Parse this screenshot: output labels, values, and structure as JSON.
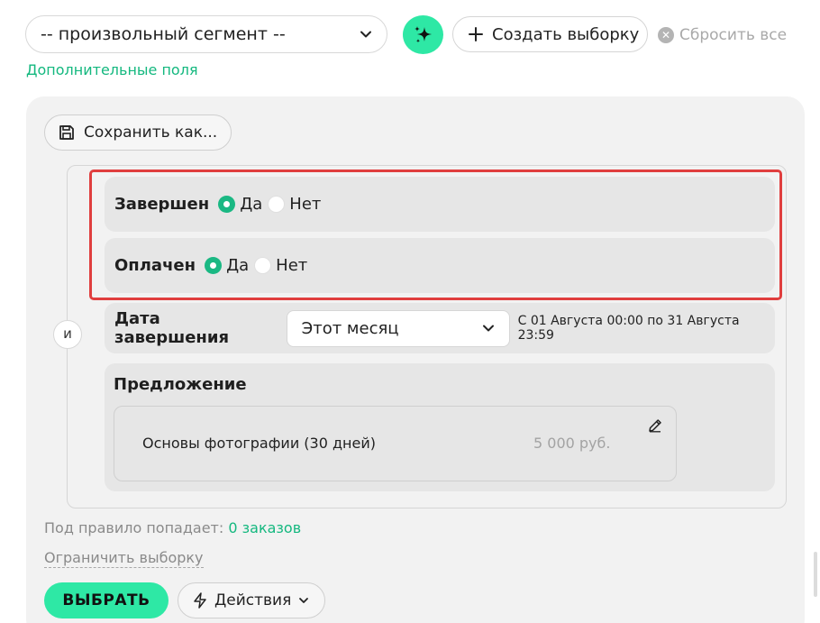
{
  "toolbar": {
    "segment_value": "-- произвольный сегмент --",
    "create_label": "Создать выборку",
    "reset_label": "Сбросить все",
    "extra_fields_link": "Дополнительные поля"
  },
  "panel": {
    "save_as_label": "Сохранить как...",
    "logic_operator": "и",
    "rules": {
      "completed": {
        "label": "Завершен",
        "options": [
          "Да",
          "Нет"
        ],
        "selected": "Да"
      },
      "paid": {
        "label": "Оплачен",
        "options": [
          "Да",
          "Нет"
        ],
        "selected": "Да"
      },
      "completion_date": {
        "label": "Дата завершения",
        "period_value": "Этот месяц",
        "range_text": "С 01 Августа 00:00 по 31 Августа 23:59"
      },
      "offer": {
        "label": "Предложение",
        "item_name": "Основы фотографии (30 дней)",
        "item_price": "5 000 руб."
      }
    },
    "match_prefix": "Под правило попадает:",
    "match_count": "0 заказов",
    "limit_link": "Ограничить выборку",
    "select_button": "ВЫБРАТЬ",
    "actions_button": "Действия"
  },
  "colors": {
    "accent": "#2ee8a5",
    "link": "#14b87f",
    "highlight": "#e03e3e"
  },
  "icons": [
    "chevron-down-icon",
    "sparkle-icon",
    "plus-icon",
    "close-icon",
    "save-icon",
    "pencil-icon",
    "lightning-icon"
  ]
}
